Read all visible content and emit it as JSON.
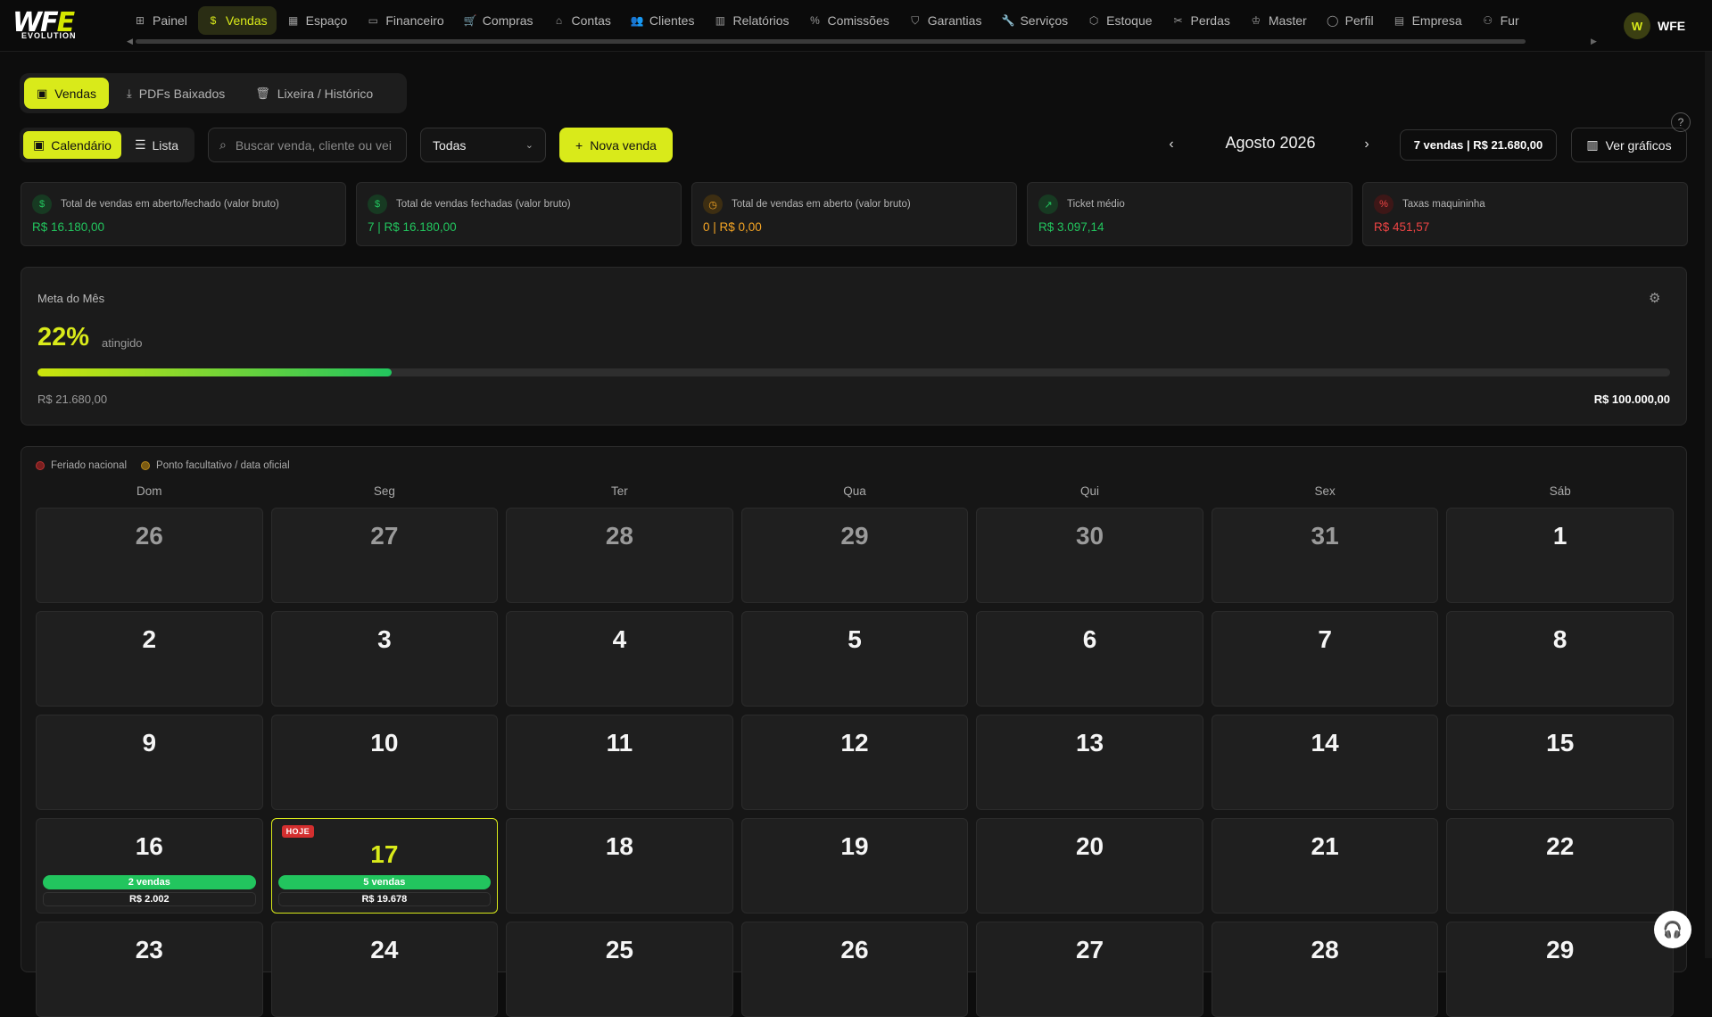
{
  "brand": {
    "logo_main_a": "WF",
    "logo_main_b": "E",
    "logo_sub": "EVOLUTION"
  },
  "nav": {
    "items": [
      {
        "label": "Painel",
        "icon": "⊞"
      },
      {
        "label": "Vendas",
        "icon": "$"
      },
      {
        "label": "Espaço",
        "icon": "▦"
      },
      {
        "label": "Financeiro",
        "icon": "▭"
      },
      {
        "label": "Compras",
        "icon": "🛒"
      },
      {
        "label": "Contas",
        "icon": "⌂"
      },
      {
        "label": "Clientes",
        "icon": "👥"
      },
      {
        "label": "Relatórios",
        "icon": "▥"
      },
      {
        "label": "Comissões",
        "icon": "%"
      },
      {
        "label": "Garantias",
        "icon": "⛉"
      },
      {
        "label": "Serviços",
        "icon": "🔧"
      },
      {
        "label": "Estoque",
        "icon": "⬡"
      },
      {
        "label": "Perdas",
        "icon": "✂"
      },
      {
        "label": "Master",
        "icon": "♔"
      },
      {
        "label": "Perfil",
        "icon": "◯"
      },
      {
        "label": "Empresa",
        "icon": "▤"
      },
      {
        "label": "Fur",
        "icon": "⚇"
      }
    ],
    "user_initial": "W",
    "user_name": "WFE"
  },
  "tabs": [
    {
      "label": "Vendas",
      "icon": "▣"
    },
    {
      "label": "PDFs Baixados",
      "icon": "⤓"
    },
    {
      "label": "Lixeira / Histórico",
      "icon": "🗑"
    }
  ],
  "toolbar": {
    "view_calendar": "Calendário",
    "view_list": "Lista",
    "search_placeholder": "Buscar venda, cliente ou vei",
    "filter_value": "Todas",
    "new_sale": "Nova venda",
    "month": "Agosto 2026",
    "month_summary": "7 vendas | R$ 21.680,00",
    "charts": "Ver gráficos"
  },
  "stats": [
    {
      "label": "Total de vendas em aberto/fechado (valor bruto)",
      "value": "R$ 16.180,00",
      "icon": "$",
      "color": "#22c55e",
      "icon_bg": "#173a22"
    },
    {
      "label": "Total de vendas fechadas (valor bruto)",
      "value": "7 | R$ 16.180,00",
      "icon": "$",
      "color": "#22c55e",
      "icon_bg": "#173a22"
    },
    {
      "label": "Total de vendas em aberto (valor bruto)",
      "value": "0 | R$ 0,00",
      "icon": "◷",
      "color": "#f5a524",
      "icon_bg": "#3d2e12"
    },
    {
      "label": "Ticket médio",
      "value": "R$ 3.097,14",
      "icon": "↗",
      "color": "#22c55e",
      "icon_bg": "#173a22"
    },
    {
      "label": "Taxas maquininha",
      "value": "R$ 451,57",
      "icon": "%",
      "color": "#ef4444",
      "icon_bg": "#3d1717"
    }
  ],
  "meta": {
    "title": "Meta do Mês",
    "percent_label": "22%",
    "percent": 0.2168,
    "suffix": "atingido",
    "current": "R$ 21.680,00",
    "goal": "R$ 100.000,00"
  },
  "calendar": {
    "legend": [
      {
        "label": "Feriado nacional",
        "color": "#7a1f1f"
      },
      {
        "label": "Ponto facultativo / data oficial",
        "color": "#7a5a12"
      }
    ],
    "weekdays": [
      "Dom",
      "Seg",
      "Ter",
      "Qua",
      "Qui",
      "Sex",
      "Sáb"
    ],
    "today_badge": "HOJE",
    "days": [
      {
        "n": "26",
        "other": true
      },
      {
        "n": "27",
        "other": true
      },
      {
        "n": "28",
        "other": true
      },
      {
        "n": "29",
        "other": true
      },
      {
        "n": "30",
        "other": true
      },
      {
        "n": "31",
        "other": true
      },
      {
        "n": "1"
      },
      {
        "n": "2"
      },
      {
        "n": "3"
      },
      {
        "n": "4"
      },
      {
        "n": "5"
      },
      {
        "n": "6"
      },
      {
        "n": "7"
      },
      {
        "n": "8"
      },
      {
        "n": "9"
      },
      {
        "n": "10"
      },
      {
        "n": "11"
      },
      {
        "n": "12"
      },
      {
        "n": "13"
      },
      {
        "n": "14"
      },
      {
        "n": "15"
      },
      {
        "n": "16",
        "sales": "2 vendas",
        "value": "R$ 2.002"
      },
      {
        "n": "17",
        "today": true,
        "sales": "5 vendas",
        "value": "R$ 19.678"
      },
      {
        "n": "18"
      },
      {
        "n": "19"
      },
      {
        "n": "20"
      },
      {
        "n": "21"
      },
      {
        "n": "22"
      },
      {
        "n": "23"
      },
      {
        "n": "24"
      },
      {
        "n": "25"
      },
      {
        "n": "26"
      },
      {
        "n": "27"
      },
      {
        "n": "28"
      },
      {
        "n": "29"
      }
    ]
  },
  "support_icon": "🎧"
}
